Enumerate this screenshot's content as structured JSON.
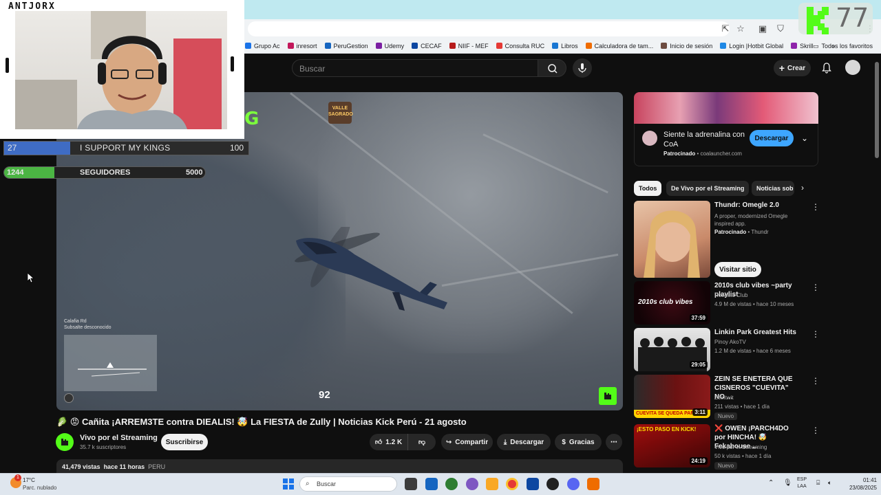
{
  "browser": {
    "bookmarks": [
      "Grupo Ac",
      "inresort",
      "PeruGestion",
      "Udemy",
      "CECAF",
      "NIIF - MEF",
      "Consulta RUC",
      "Libros",
      "Calculadora de tam...",
      "Inicio de sesión",
      "Login |Hotbit Global",
      "Skrill"
    ],
    "bookmark_colors": [
      "#1a73e8",
      "#c2185b",
      "#1565c0",
      "#7b1fa2",
      "#0d47a1",
      "#b71c1c",
      "#e53935",
      "#1976d2",
      "#ef6c00",
      "#6d4c41",
      "#1e88e5",
      "#8e24aa"
    ],
    "all_bookmarks": "Todos los favoritos"
  },
  "overlay": {
    "channel_tag": "ANTJORX",
    "support_current": "27",
    "support_label": "I SUPPORT MY KINGS",
    "support_goal": "100",
    "support_progress": 0.27,
    "followers_current": "1244",
    "followers_label": "SEGUIDORES",
    "followers_goal": "5000",
    "followers_progress": 0.2488,
    "kick_number": "77"
  },
  "header": {
    "search_placeholder": "Buscar",
    "create_label": "Crear"
  },
  "player": {
    "game_logo_line1": "VALLE",
    "game_logo_line2": "SAGRADO",
    "overlay_text": "G",
    "minimap_line1": "Calafia Rd",
    "minimap_line2": "Subsalte desconocido",
    "speed": "92"
  },
  "video": {
    "title": "🥬 😡 Cañita ¡ARREM3TE contra DIEALIS! 🤯 La FIESTA de Zully | Noticias Kick Perú - 21 agosto",
    "channel": "Vivo por el Streaming",
    "subscribers": "35.7 k suscriptores",
    "subscribe_label": "Suscribirse",
    "likes": "1.2 K",
    "share_label": "Compartir",
    "download_label": "Descargar",
    "thanks_label": "Gracias",
    "views": "41,479 vistas",
    "time_ago": "hace 11 horas",
    "location": "PERU"
  },
  "ad": {
    "title": "Siente la adrenalina con CoA",
    "sponsored": "Patrocinado",
    "domain": "coalauncher.com",
    "cta": "Descargar"
  },
  "chips": [
    "Todos",
    "De Vivo por el Streaming",
    "Noticias sob"
  ],
  "recommendations": [
    {
      "title": "Thundr: Omegle 2.0",
      "line1": "A proper, modernized Omegle inspired app.",
      "sponsor": "Patrocinado",
      "sponsor_name": "Thundr",
      "cta": "Visitar sitio"
    },
    {
      "title": "2010s club vibes ~party playlist",
      "channel": "Roseate Club",
      "meta": "4.9 M de vistas • hace 10 meses",
      "duration": "37:59",
      "thumb_text": "2010s club vibes"
    },
    {
      "title": "Linkin Park Greatest Hits",
      "channel": "Pinoy AkoTV",
      "meta": "1.2 M de vistas • hace 6 meses",
      "duration": "29:05"
    },
    {
      "title": "ZEIN SE ENETERA QUE CISNEROS \"CUEVITA\" NO ...",
      "channel": "Zeintwit",
      "meta": "211 vistas • hace 1 día",
      "duration": "3:11",
      "badge": "Nuevo",
      "thumb_text": "CUEVITA SE QUEDA PARA C"
    },
    {
      "title": "❌ OWEN ¡PARCH4DO por HINCHA! 🤯 Fekahouse ...",
      "channel": "Vivo por el Streaming",
      "meta": "50 k vistas • hace 1 día",
      "duration": "24:19",
      "badge": "Nuevo",
      "thumb_text": "¡ESTO PASO EN KICK!"
    }
  ],
  "taskbar": {
    "temp": "17°C",
    "weather": "Parc. nublado",
    "search": "Buscar",
    "lang1": "ESP",
    "lang2": "LAA",
    "time": "01:41",
    "date": "23/08/2025",
    "notif_count": "1"
  }
}
